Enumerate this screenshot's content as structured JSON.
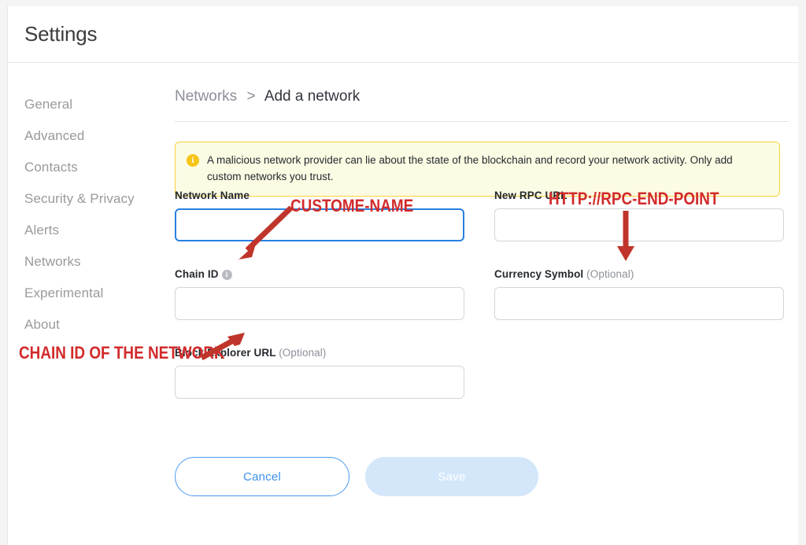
{
  "window": {
    "title": "Settings"
  },
  "sidebar": {
    "items": [
      {
        "label": "General"
      },
      {
        "label": "Advanced"
      },
      {
        "label": "Contacts"
      },
      {
        "label": "Security & Privacy"
      },
      {
        "label": "Alerts"
      },
      {
        "label": "Networks"
      },
      {
        "label": "Experimental"
      },
      {
        "label": "About"
      }
    ]
  },
  "breadcrumb": {
    "root": "Networks",
    "separator": ">",
    "current": "Add a network"
  },
  "warning": {
    "icon": "info-icon",
    "text": "A malicious network provider can lie about the state of the blockchain and record your network activity. Only add custom networks you trust.",
    "background_color": "#fcfbe3",
    "border_color": "#f8d33c",
    "icon_color": "#f5c518"
  },
  "form": {
    "network_name": {
      "label": "Network Name",
      "value": "",
      "placeholder": "",
      "focused": true,
      "focus_color": "#277fe0"
    },
    "rpc_url": {
      "label": "New RPC URL",
      "value": "",
      "placeholder": "",
      "focused": false
    },
    "chain_id": {
      "label": "Chain ID",
      "info_icon": "info-icon",
      "value": "",
      "placeholder": "",
      "focused": false
    },
    "currency_symbol": {
      "label": "Currency Symbol",
      "optional": "(Optional)",
      "value": "",
      "placeholder": "",
      "focused": false
    },
    "block_explorer_url": {
      "label": "Block Explorer URL",
      "optional": "(Optional)",
      "value": "",
      "placeholder": "",
      "focused": false
    }
  },
  "buttons": {
    "cancel": {
      "label": "Cancel",
      "color": "#3d92ee",
      "border_color": "#4b9cf0"
    },
    "save": {
      "label": "Save",
      "disabled": true,
      "background_color": "#d4e7fa",
      "color": "#ffffff"
    }
  },
  "annotations": {
    "color": "#d22b2b",
    "items": [
      {
        "text": "CUSTOME-NAME",
        "target": "network-name-input",
        "arrow": "down-left"
      },
      {
        "text": "HTTP://RPC-END-POINT",
        "target": "rpc-url-input",
        "arrow": "down"
      },
      {
        "text": "CHAIN ID OF THE NETWORK",
        "target": "chain-id-input",
        "arrow": "up-right"
      }
    ]
  }
}
